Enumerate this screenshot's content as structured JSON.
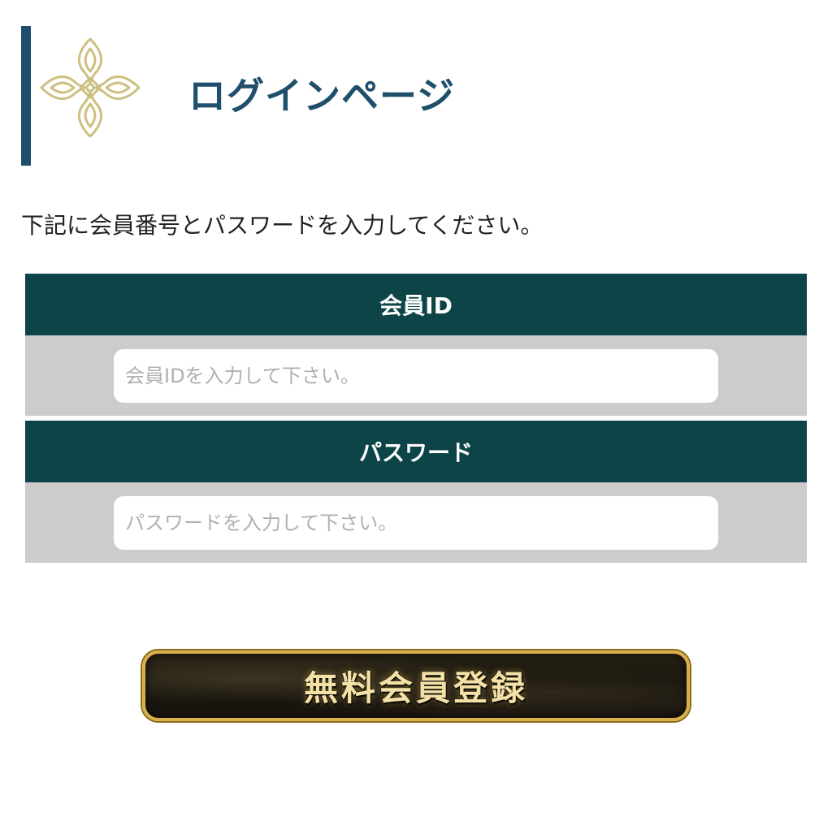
{
  "header": {
    "title": "ログインページ",
    "ornament_icon": "gold-ornament-icon",
    "accent_color": "#1f4f6d"
  },
  "instruction": "下記に会員番号とパスワードを入力してください。",
  "form": {
    "member_id": {
      "label": "会員ID",
      "value": "",
      "placeholder": "会員IDを入力して下さい。"
    },
    "password": {
      "label": "パスワード",
      "value": "",
      "placeholder": "パスワードを入力して下さい。"
    },
    "header_color": "#0d4448",
    "body_color": "#cccccc"
  },
  "register_button": {
    "label": "無料会員登録",
    "border_color": "#d9b04a"
  }
}
